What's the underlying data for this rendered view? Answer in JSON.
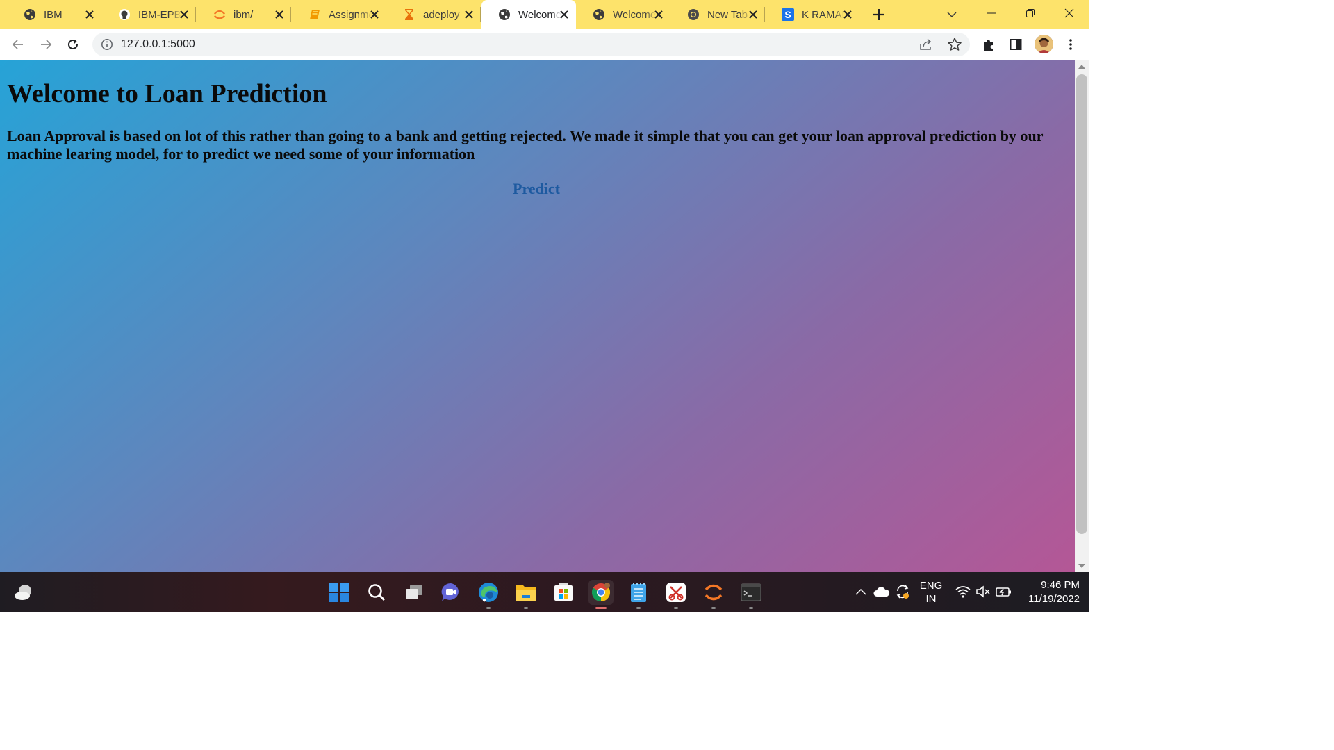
{
  "browser": {
    "tabs": [
      {
        "title": "IBM",
        "icon": "globe-icon",
        "active": false
      },
      {
        "title": "IBM-EPBL",
        "icon": "github-icon",
        "active": false
      },
      {
        "title": "ibm/",
        "icon": "jupyter-icon",
        "active": false
      },
      {
        "title": "Assignment",
        "icon": "notebook-icon",
        "active": false
      },
      {
        "title": "adeploy",
        "icon": "hourglass-icon",
        "active": false
      },
      {
        "title": "Welcome",
        "icon": "globe-icon",
        "active": true
      },
      {
        "title": "Welcome",
        "icon": "globe-icon",
        "active": false
      },
      {
        "title": "New Tab",
        "icon": "chrome-icon",
        "active": false
      },
      {
        "title": "K RAMAN",
        "icon": "s-logo-icon",
        "active": false
      }
    ],
    "address": {
      "url": "127.0.0.1:5000"
    },
    "colors": {
      "tab_strip": "#fde36b",
      "active_tab": "#ffffff"
    }
  },
  "page": {
    "heading": "Welcome to Loan Prediction",
    "intro": "Loan Approval is based on lot of this rather than going to a bank and getting rejected. We made it simple that you can get your loan approval prediction by our machine learing model, for to predict we need some of your information",
    "predict_link": "Predict",
    "colors": {
      "gradient_start": "#26a3d7",
      "gradient_end": "#b45796",
      "link": "#1e5aa0"
    }
  },
  "taskbar": {
    "apps": [
      "weather-icon",
      "windows-start-icon",
      "search-icon",
      "task-view-icon",
      "chat-icon",
      "edge-icon",
      "file-explorer-icon",
      "store-icon",
      "chrome-icon",
      "notepad-icon",
      "snipping-tool-icon",
      "jupyter-icon",
      "terminal-icon"
    ],
    "language": {
      "line1": "ENG",
      "line2": "IN"
    },
    "clock": {
      "time": "9:46 PM",
      "date": "11/19/2022"
    }
  }
}
